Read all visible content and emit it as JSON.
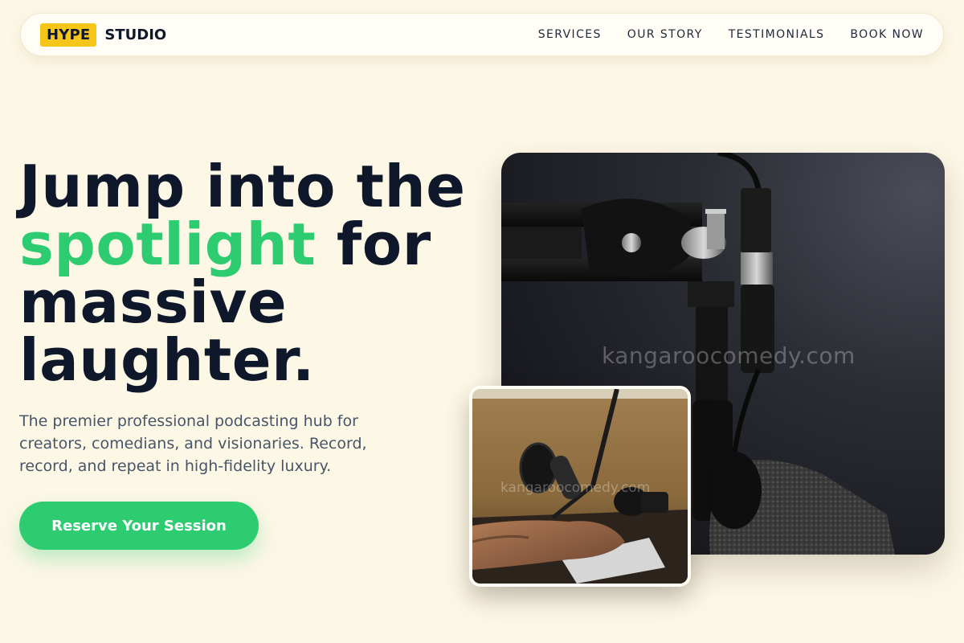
{
  "brand": {
    "tag": "HYPE",
    "name": "STUDIO",
    "tag_color": "#f5c518"
  },
  "nav": {
    "links": [
      {
        "label": "SERVICES"
      },
      {
        "label": "OUR STORY"
      },
      {
        "label": "TESTIMONIALS"
      },
      {
        "label": "BOOK NOW"
      }
    ]
  },
  "hero": {
    "title_line1": "Jump into the",
    "title_accent": "spotlight",
    "title_after_accent": " for",
    "title_line3": "massive",
    "title_line4": "laughter.",
    "description": "The premier professional podcasting hub for creators, comedians, and visionaries. Record, record, and repeat in high-fidelity luxury.",
    "cta_label": "Reserve Your Session",
    "accent_color": "#2ecc71"
  },
  "images": {
    "main_watermark": "kangaroocomedy.com",
    "small_watermark": "kangaroocomedy.com"
  },
  "colors": {
    "background": "#fdf7e6",
    "heading": "#0f172a",
    "body_text": "#475569"
  }
}
